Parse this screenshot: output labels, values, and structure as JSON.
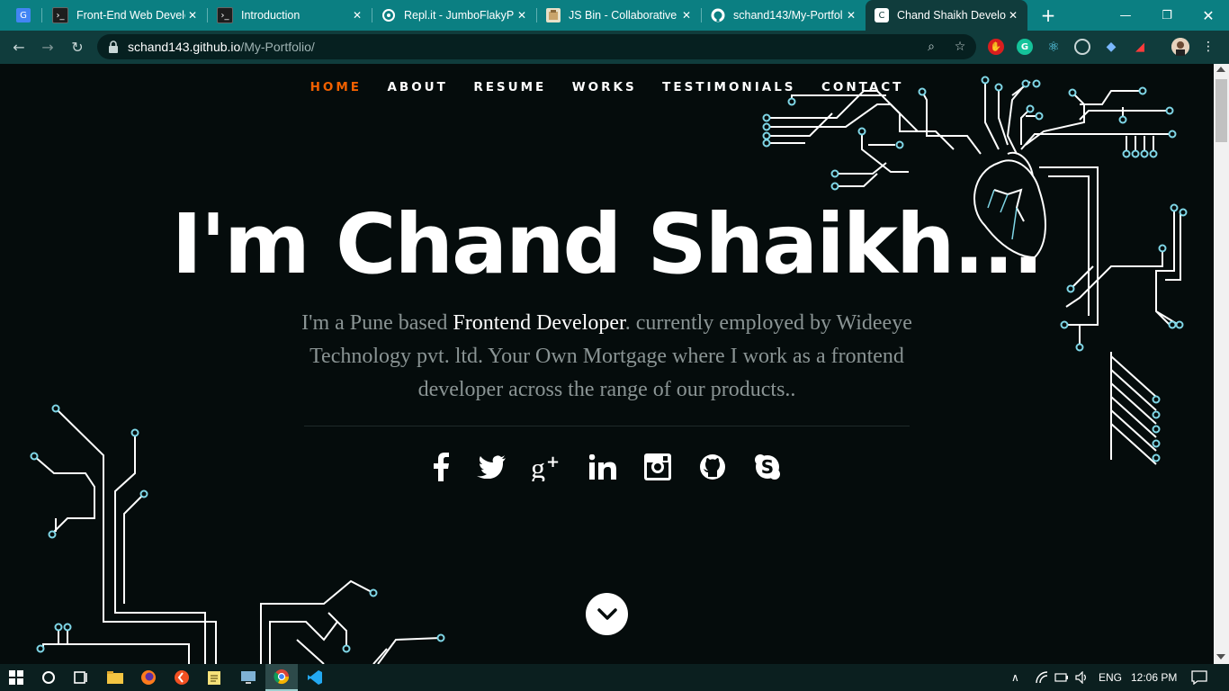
{
  "browser": {
    "tabs": [
      {
        "title": "Front-End Web Develo",
        "icon": "terminal-icon"
      },
      {
        "title": "Introduction",
        "icon": "terminal-icon"
      },
      {
        "title": "Repl.it - JumboFlakyPr",
        "icon": "replit-icon"
      },
      {
        "title": "JS Bin - Collaborative J",
        "icon": "jsbin-icon"
      },
      {
        "title": "schand143/My-Portfol",
        "icon": "github-icon"
      },
      {
        "title": "Chand Shaikh Develop",
        "icon": "portfolio-icon"
      }
    ],
    "new_tab": "+",
    "url_host": "schand143.github.io",
    "url_path": "/My-Portfolio/"
  },
  "nav": {
    "items": [
      "HOME",
      "ABOUT",
      "RESUME",
      "WORKS",
      "TESTIMONIALS",
      "CONTACT"
    ],
    "active": "HOME",
    "active_color": "#f06000"
  },
  "hero": {
    "title": "I'm Chand Shaikh...",
    "text_before": "I'm a Pune based ",
    "text_strong": "Frontend Developer",
    "text_after": ". currently employed by Wideeye Technology pvt. ltd. Your Own Mortgage where I work as a frontend developer across the range of our products.."
  },
  "social": [
    "facebook-icon",
    "twitter-icon",
    "google-plus-icon",
    "linkedin-icon",
    "instagram-icon",
    "github-icon",
    "skype-icon"
  ],
  "taskbar": {
    "language": "ENG",
    "time": "12:06 PM"
  },
  "colors": {
    "tab_strip": "#0b7f82",
    "toolbar": "#103c3c",
    "page_bg": "#050c0c",
    "circuit_node": "#7fd6e6"
  }
}
